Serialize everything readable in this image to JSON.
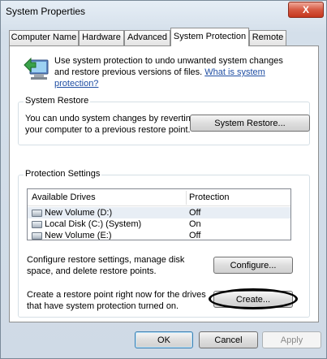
{
  "window": {
    "title": "System Properties",
    "close_label": "X"
  },
  "tabs": [
    {
      "label": "Computer Name",
      "active": false
    },
    {
      "label": "Hardware",
      "active": false
    },
    {
      "label": "Advanced",
      "active": false
    },
    {
      "label": "System Protection",
      "active": true
    },
    {
      "label": "Remote",
      "active": false
    }
  ],
  "info": {
    "text": "Use system protection to undo unwanted system changes and restore previous versions of files.",
    "link": "What is system protection?"
  },
  "system_restore": {
    "label": "System Restore",
    "description": "You can undo system changes by reverting your computer to a previous restore point.",
    "button": "System Restore..."
  },
  "protection_settings": {
    "label": "Protection Settings",
    "columns": [
      "Available Drives",
      "Protection"
    ],
    "drives": [
      {
        "name": "New Volume (D:)",
        "protection": "Off",
        "selected": true
      },
      {
        "name": "Local Disk (C:) (System)",
        "protection": "On",
        "selected": false
      },
      {
        "name": "New Volume (E:)",
        "protection": "Off",
        "selected": false
      }
    ],
    "configure_text": "Configure restore settings, manage disk space, and delete restore points.",
    "configure_button": "Configure...",
    "create_text": "Create a restore point right now for the drives that have system protection turned on.",
    "create_button": "Create..."
  },
  "footer": {
    "ok": "OK",
    "cancel": "Cancel",
    "apply": "Apply"
  }
}
